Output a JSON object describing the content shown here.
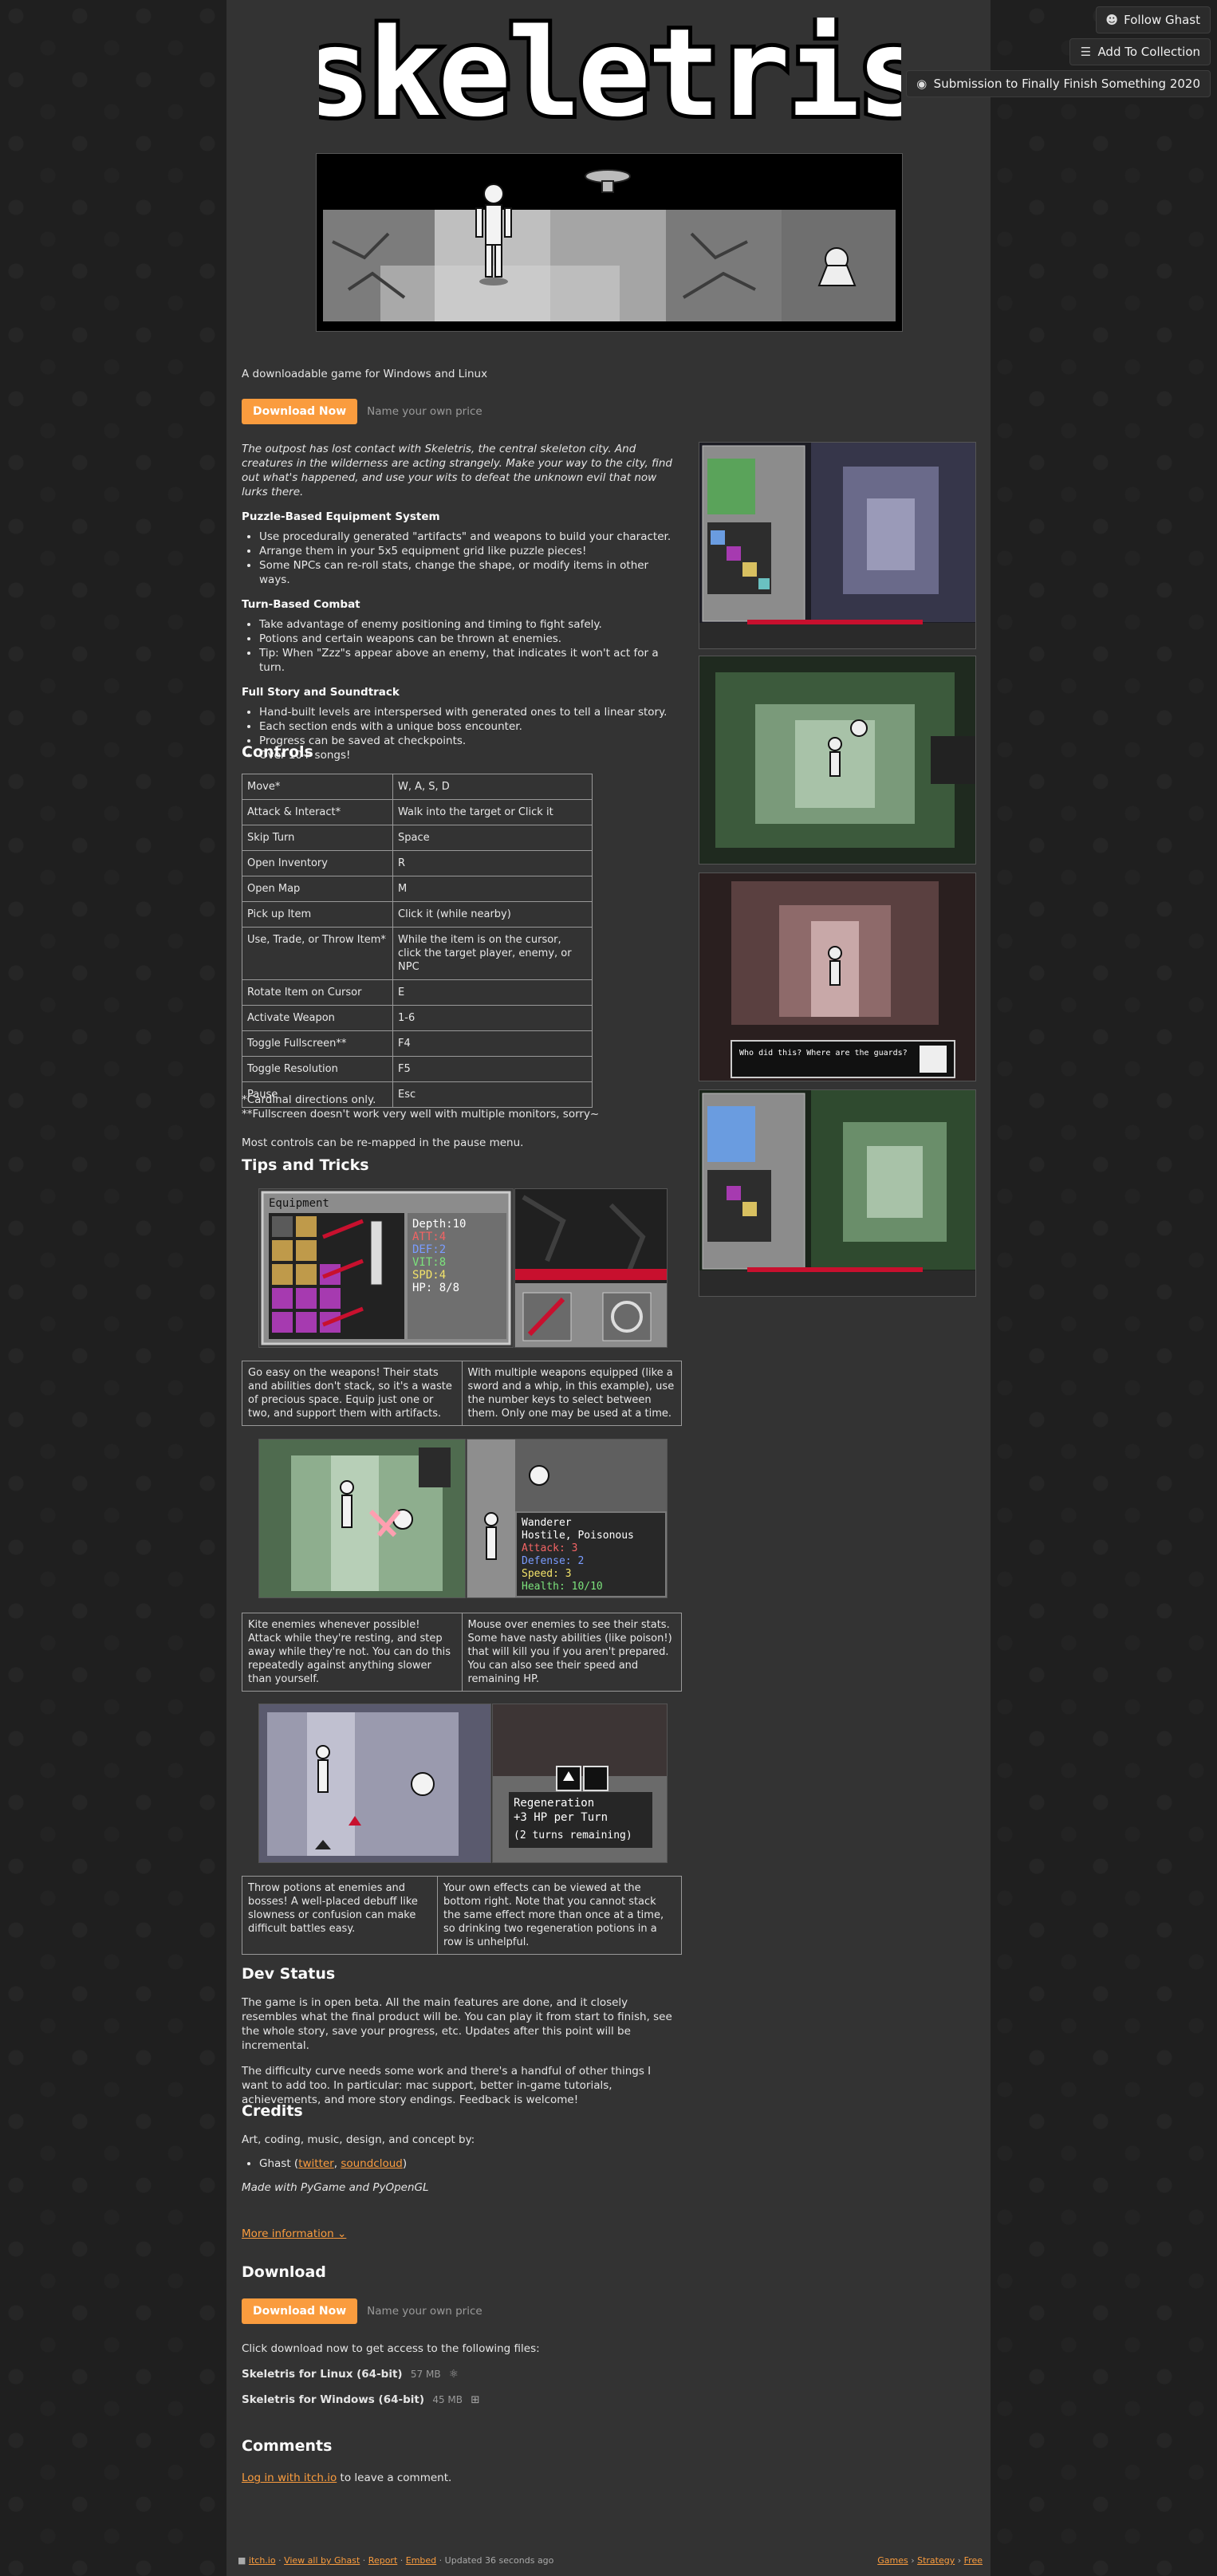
{
  "top_buttons": {
    "follow": "Follow Ghast",
    "collection": "Add To Collection",
    "jam": "Submission to Finally Finish Something 2020"
  },
  "logo_text": "skeletris",
  "tagline": "A downloadable game for Windows and Linux",
  "purchase": {
    "button": "Download Now",
    "hint": "Name your own price"
  },
  "intro": "The outpost has lost contact with Skeletris, the central skeleton city. And creatures in the wilderness are acting strangely. Make your way to the city, find out what's happened, and use your wits to defeat the unknown evil that now lurks there.",
  "sections": [
    {
      "title": "Puzzle-Based Equipment System",
      "items": [
        "Use procedurally generated \"artifacts\" and weapons to build your character.",
        "Arrange them in your 5x5 equipment grid like puzzle pieces!",
        "Some NPCs can re-roll stats, change the shape, or modify items in other ways."
      ]
    },
    {
      "title": "Turn-Based Combat",
      "items": [
        "Take advantage of enemy positioning and timing to fight safely.",
        "Potions and certain weapons can be thrown at enemies.",
        "Tip: When \"Zzz\"s appear above an enemy, that indicates it won't act for a turn."
      ]
    },
    {
      "title": "Full Story and Soundtrack",
      "items": [
        "Hand-built levels are interspersed with generated ones to tell a linear story.",
        "Each section ends with a unique boss encounter.",
        "Progress can be saved at checkpoints.",
        "Over 10+ songs!"
      ]
    }
  ],
  "controls": {
    "title": "Controls",
    "rows": [
      [
        "Move*",
        "W, A, S, D"
      ],
      [
        "Attack & Interact*",
        "Walk into the target or Click it"
      ],
      [
        "Skip Turn",
        "Space"
      ],
      [
        "Open Inventory",
        "R"
      ],
      [
        "Open Map",
        "M"
      ],
      [
        "Pick up Item",
        "Click it (while nearby)"
      ],
      [
        "Use, Trade, or Throw Item*",
        "While the item is on the cursor, click the target player, enemy, or NPC"
      ],
      [
        "Rotate Item on Cursor",
        "E"
      ],
      [
        "Activate Weapon",
        "1-6"
      ],
      [
        "Toggle Fullscreen**",
        "F4"
      ],
      [
        "Toggle Resolution",
        "F5"
      ],
      [
        "Pause",
        "Esc"
      ]
    ],
    "note1": "*Cardinal directions only.",
    "note2": "**Fullscreen doesn't work very well with multiple monitors, sorry~",
    "note3": "Most controls can be re-mapped in the pause menu."
  },
  "tips": {
    "title": "Tips and Tricks",
    "pairs": [
      [
        "Go easy on the weapons! Their stats and abilities don't stack, so it's a waste of precious space. Equip just one or two, and support them with artifacts.",
        "With multiple weapons equipped (like a sword and a whip, in this example), use the number keys to select between them. Only one may be used at a time."
      ],
      [
        "Kite enemies whenever possible! Attack while they're resting, and step away while they're not. You can do this repeatedly against anything slower than yourself.",
        "Mouse over enemies to see their stats. Some have nasty abilities (like poison!) that will kill you if you aren't prepared. You can also see their speed and remaining HP."
      ],
      [
        "Throw potions at enemies and bosses! A well-placed debuff like slowness or confusion can make difficult battles easy.",
        "Your own effects can be viewed at the bottom right. Note that you cannot stack the same effect more than once at a time, so drinking two regeneration potions in a row is unhelpful."
      ]
    ],
    "equip_panel": {
      "title": "Equipment",
      "depth": "Depth:10",
      "att": "ATT:4",
      "def": "DEF:2",
      "vit": "VIT:8",
      "spd": "SPD:4",
      "hp": "HP: 8/8"
    },
    "enemy_panel": {
      "name": "Wanderer",
      "traits": "Hostile, Poisonous",
      "attack": "Attack: 3",
      "defense": "Defense: 2",
      "speed": "Speed: 3",
      "health": "Health: 10/10"
    },
    "effect_panel": {
      "name": "Regeneration",
      "desc": "+3 HP per Turn",
      "turns": "(2 turns remaining)"
    }
  },
  "dialog_text": "Who did this? Where are the guards?",
  "dev": {
    "title": "Dev Status",
    "p1": "The game is in open beta. All the main features are done, and it closely resembles what the final product will be. You can play it from start to finish, see the whole story, save your progress, etc. Updates after this point will be incremental.",
    "p2": "The difficulty curve needs some work and there's a handful of other things I want to add too. In particular: mac support, better in-game tutorials, achievements, and more story endings. Feedback is welcome!"
  },
  "credits": {
    "title": "Credits",
    "line": "Art, coding, music, design, and concept by:",
    "name": "Ghast",
    "twitter": "twitter",
    "soundcloud": "soundcloud",
    "made_with": "Made with PyGame and PyOpenGL"
  },
  "more_info": "More information",
  "download": {
    "title": "Download",
    "button": "Download Now",
    "hint": "Name your own price",
    "instructions": "Click download now to get access to the following files:",
    "files": [
      {
        "name": "Skeletris for Linux (64-bit)",
        "size": "57 MB",
        "icon": "linux-icon"
      },
      {
        "name": "Skeletris for Windows (64-bit)",
        "size": "45 MB",
        "icon": "windows-icon"
      }
    ]
  },
  "comments": {
    "title": "Comments",
    "login": "Log in with itch.io",
    "suffix": " to leave a comment."
  },
  "footer": {
    "site": "itch.io",
    "view_all": "View all by Ghast",
    "report": "Report",
    "embed": "Embed",
    "updated": "Updated 36 seconds ago",
    "games": "Games",
    "strategy": "Strategy",
    "free": "Free"
  },
  "colors": {
    "accent": "#fa9c3e",
    "column_bg": "#333333",
    "page_bg": "#1f1f1f"
  }
}
